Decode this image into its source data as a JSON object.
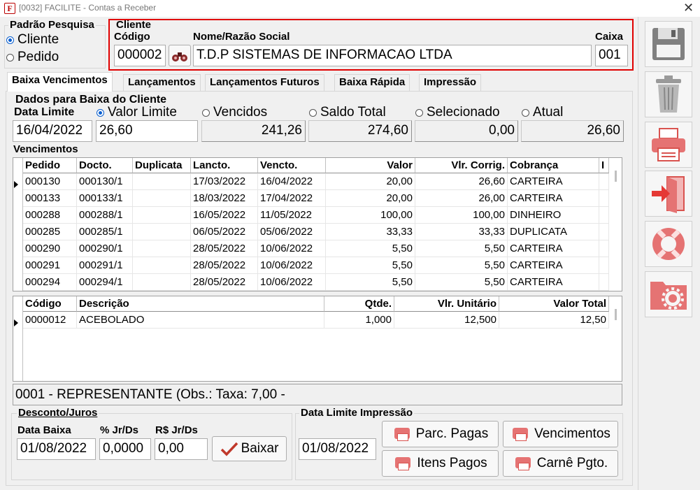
{
  "window": {
    "title": "[0032] FACILITE - Contas a Receber",
    "app_icon": "F",
    "close": "✕"
  },
  "search_mode": {
    "label": "Padrão Pesquisa",
    "options": [
      {
        "label": "Cliente",
        "selected": true
      },
      {
        "label": "Pedido",
        "selected": false
      }
    ]
  },
  "cliente": {
    "group_label": "Cliente",
    "code_label": "Código",
    "code_value": "000002",
    "name_label": "Nome/Razão Social",
    "name_value": "T.D.P SISTEMAS DE INFORMACAO LTDA",
    "caixa_label": "Caixa",
    "caixa_value": "001",
    "highlight_color": "#e00000"
  },
  "tabs": [
    {
      "label": "Baixa Vencimentos",
      "active": true
    },
    {
      "label": "Lançamentos",
      "active": false
    },
    {
      "label": "Lançamentos Futuros",
      "active": false
    },
    {
      "label": "Baixa Rápida",
      "active": false
    },
    {
      "label": "Impressão",
      "active": false
    }
  ],
  "dados": {
    "group_label": "Dados para Baixa do Cliente",
    "data_limite_label": "Data Limite",
    "data_limite_value": "16/04/2022",
    "options": [
      {
        "label": "Valor Limite",
        "selected": true,
        "value": "26,60"
      },
      {
        "label": "Vencidos",
        "selected": false,
        "value": "241,26"
      },
      {
        "label": "Saldo Total",
        "selected": false,
        "value": "274,60"
      },
      {
        "label": "Selecionado",
        "selected": false,
        "value": "0,00"
      },
      {
        "label": "Atual",
        "selected": false,
        "value": "26,60"
      }
    ]
  },
  "vencimentos": {
    "label": "Vencimentos",
    "columns": [
      "Pedido",
      "Docto.",
      "Duplicata",
      "Lancto.",
      "Vencto.",
      "Valor",
      "Vlr. Corrig.",
      "Cobrança",
      "I"
    ],
    "rows": [
      [
        "000130",
        "000130/1",
        "",
        "17/03/2022",
        "16/04/2022",
        "20,00",
        "26,60",
        "CARTEIRA"
      ],
      [
        "000133",
        "000133/1",
        "",
        "18/03/2022",
        "17/04/2022",
        "20,00",
        "26,00",
        "CARTEIRA"
      ],
      [
        "000288",
        "000288/1",
        "",
        "16/05/2022",
        "11/05/2022",
        "100,00",
        "100,00",
        "DINHEIRO"
      ],
      [
        "000285",
        "000285/1",
        "",
        "06/05/2022",
        "05/06/2022",
        "33,33",
        "33,33",
        "DUPLICATA"
      ],
      [
        "000290",
        "000290/1",
        "",
        "28/05/2022",
        "10/06/2022",
        "5,50",
        "5,50",
        "CARTEIRA"
      ],
      [
        "000291",
        "000291/1",
        "",
        "28/05/2022",
        "10/06/2022",
        "5,50",
        "5,50",
        "CARTEIRA"
      ],
      [
        "000294",
        "000294/1",
        "",
        "28/05/2022",
        "10/06/2022",
        "5,50",
        "5,50",
        "CARTEIRA"
      ]
    ]
  },
  "itens": {
    "columns": [
      "Código",
      "Descrição",
      "Qtde.",
      "Vlr. Unitário",
      "Valor Total"
    ],
    "rows": [
      [
        "0000012",
        "ACEBOLADO",
        "1,000",
        "12,500",
        "12,50"
      ]
    ]
  },
  "status_bar": "0001 - REPRESENTANTE (Obs.: Taxa: 7,00 -",
  "desconto": {
    "group_label": "Desconto/Juros",
    "data_baixa_label": "Data Baixa",
    "data_baixa_value": "01/08/2022",
    "pct_label": "% Jr/Ds",
    "pct_value": "0,0000",
    "rs_label": "R$ Jr/Ds",
    "rs_value": "0,00",
    "baixar_label": "Baixar"
  },
  "impressao": {
    "group_label": "Data Limite Impressão",
    "date_value": "01/08/2022",
    "buttons": [
      "Parc. Pagas",
      "Vencimentos",
      "Itens Pagos",
      "Carnê Pgto."
    ]
  },
  "colors": {
    "accent_blue": "#0a5fcf",
    "icon_red": "#d9534f"
  }
}
